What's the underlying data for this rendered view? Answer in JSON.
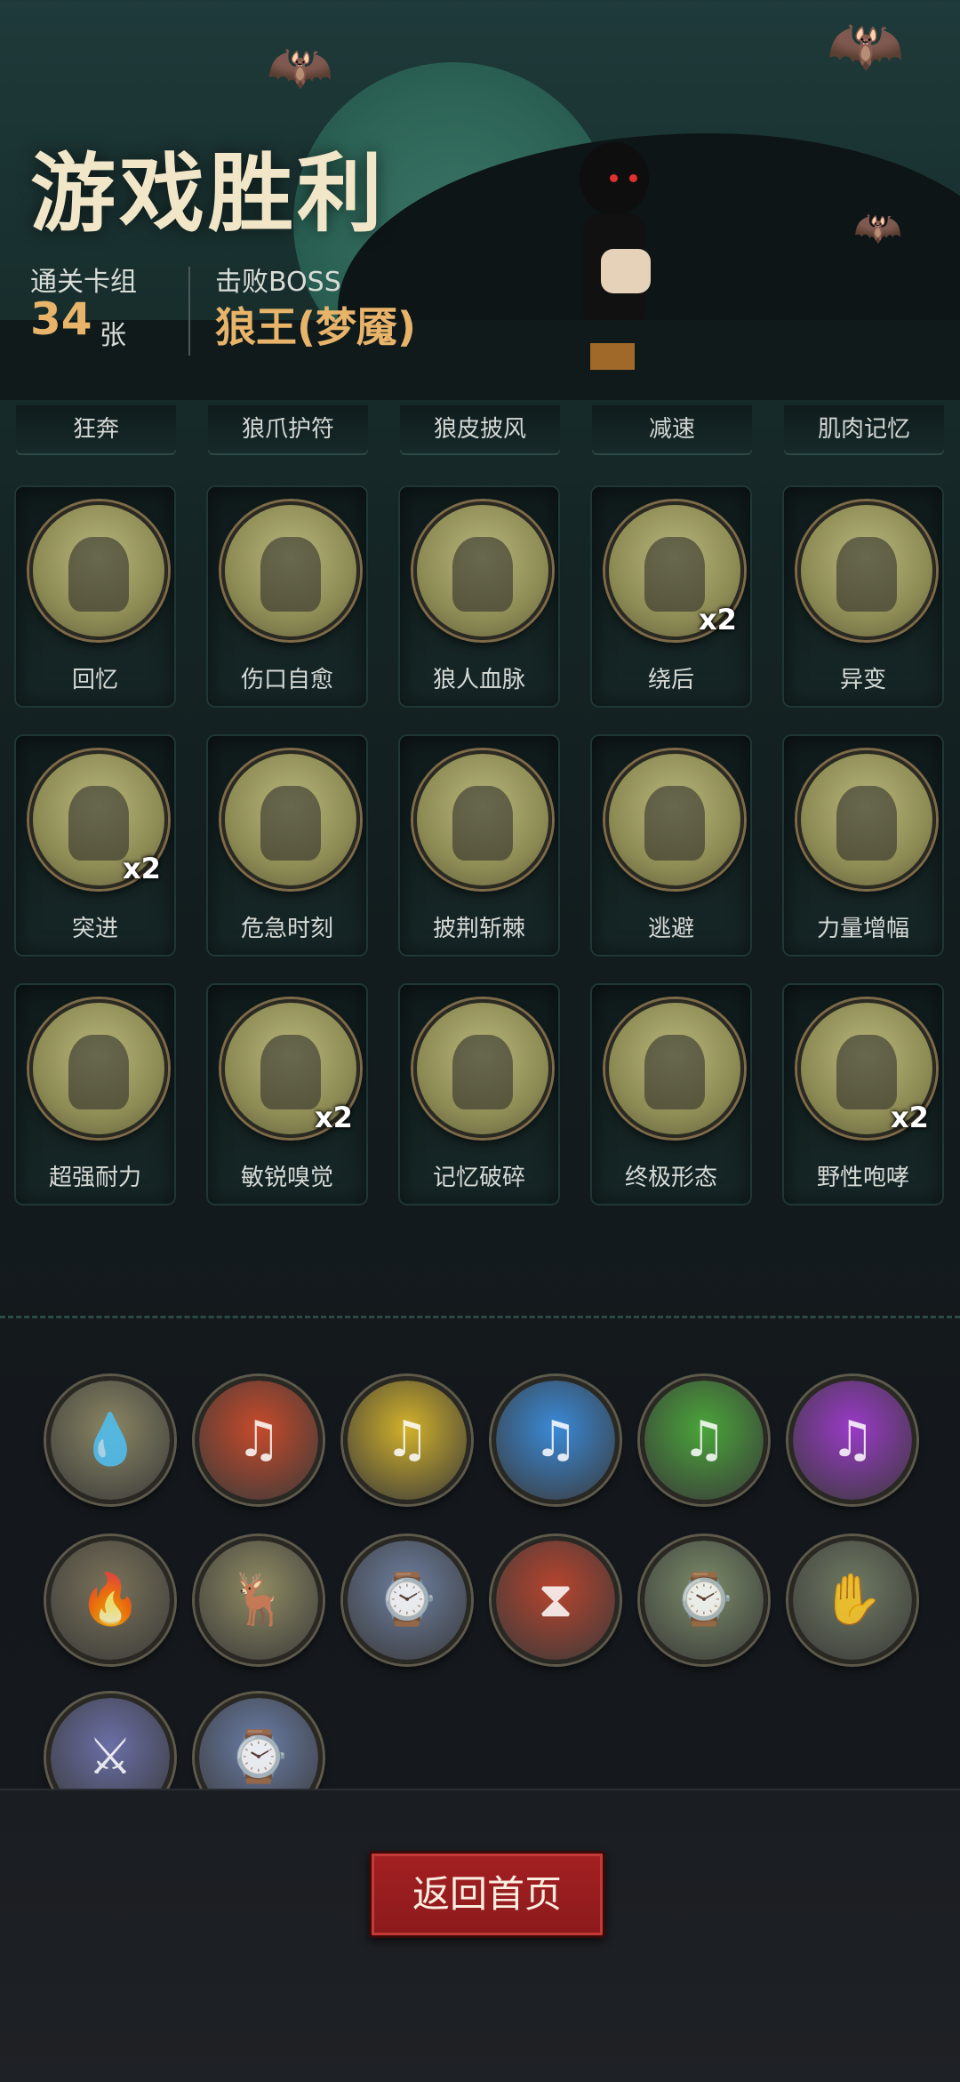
{
  "header": {
    "title": "游戏胜利",
    "deck_label": "通关卡组",
    "deck_count": "34",
    "deck_unit": "张",
    "boss_label": "击败BOSS",
    "boss_name": "狼王(梦魇)"
  },
  "partial_row": [
    "狂奔",
    "狼爪护符",
    "狼皮披风",
    "减速",
    "肌肉记忆"
  ],
  "cards": [
    {
      "label": "回忆",
      "badge": "",
      "icon": "old-man-phone-icon"
    },
    {
      "label": "伤口自愈",
      "badge": "",
      "icon": "wounded-boy-icon"
    },
    {
      "label": "狼人血脉",
      "badge": "",
      "icon": "thorny-hand-icon"
    },
    {
      "label": "绕后",
      "badge": "x2",
      "icon": "zombie-ambush-icon"
    },
    {
      "label": "异变",
      "badge": "",
      "icon": "shadow-mutation-icon"
    },
    {
      "label": "突进",
      "badge": "x2",
      "icon": "werewolf-dash-icon"
    },
    {
      "label": "危急时刻",
      "badge": "",
      "icon": "boy-fighting-icon"
    },
    {
      "label": "披荆斩棘",
      "badge": "",
      "icon": "axe-thorns-icon"
    },
    {
      "label": "逃避",
      "badge": "",
      "icon": "bear-chase-icon"
    },
    {
      "label": "力量增幅",
      "badge": "",
      "icon": "log-carry-icon"
    },
    {
      "label": "超强耐力",
      "badge": "",
      "icon": "boy-slide-icon"
    },
    {
      "label": "敏锐嗅觉",
      "badge": "x2",
      "icon": "wolf-sniff-icon"
    },
    {
      "label": "记忆破碎",
      "badge": "",
      "icon": "broken-memory-icon"
    },
    {
      "label": "终极形态",
      "badge": "",
      "icon": "white-werewolf-icon"
    },
    {
      "label": "野性咆哮",
      "badge": "x2",
      "icon": "howling-wolf-icon"
    }
  ],
  "relics": [
    {
      "icon": "water-drop-relic-icon",
      "color": "#8a8663"
    },
    {
      "icon": "red-music-beast-icon",
      "color": "#c74a2a"
    },
    {
      "icon": "yellow-music-beast-icon",
      "color": "#d2b22a"
    },
    {
      "icon": "blue-music-beast-icon",
      "color": "#3a8ad8"
    },
    {
      "icon": "green-music-beast-icon",
      "color": "#4aa53a"
    },
    {
      "icon": "purple-music-beast-icon",
      "color": "#9a3ac8"
    },
    {
      "icon": "fire-altar-icon",
      "color": "#7a7258"
    },
    {
      "icon": "deer-icon",
      "color": "#8f8b62"
    },
    {
      "icon": "frozen-compass-icon",
      "color": "#6d7fa0"
    },
    {
      "icon": "hourglass-creature-icon",
      "color": "#b8442e"
    },
    {
      "icon": "frozen-compass-icon",
      "color": "#7a8c68"
    },
    {
      "icon": "card-hand-icon",
      "color": "#6f7a62"
    },
    {
      "icon": "warrior-relic-icon",
      "color": "#6a6fa6"
    },
    {
      "icon": "frozen-compass-icon",
      "color": "#6a7ea8"
    }
  ],
  "footer": {
    "back_label": "返回首页"
  }
}
